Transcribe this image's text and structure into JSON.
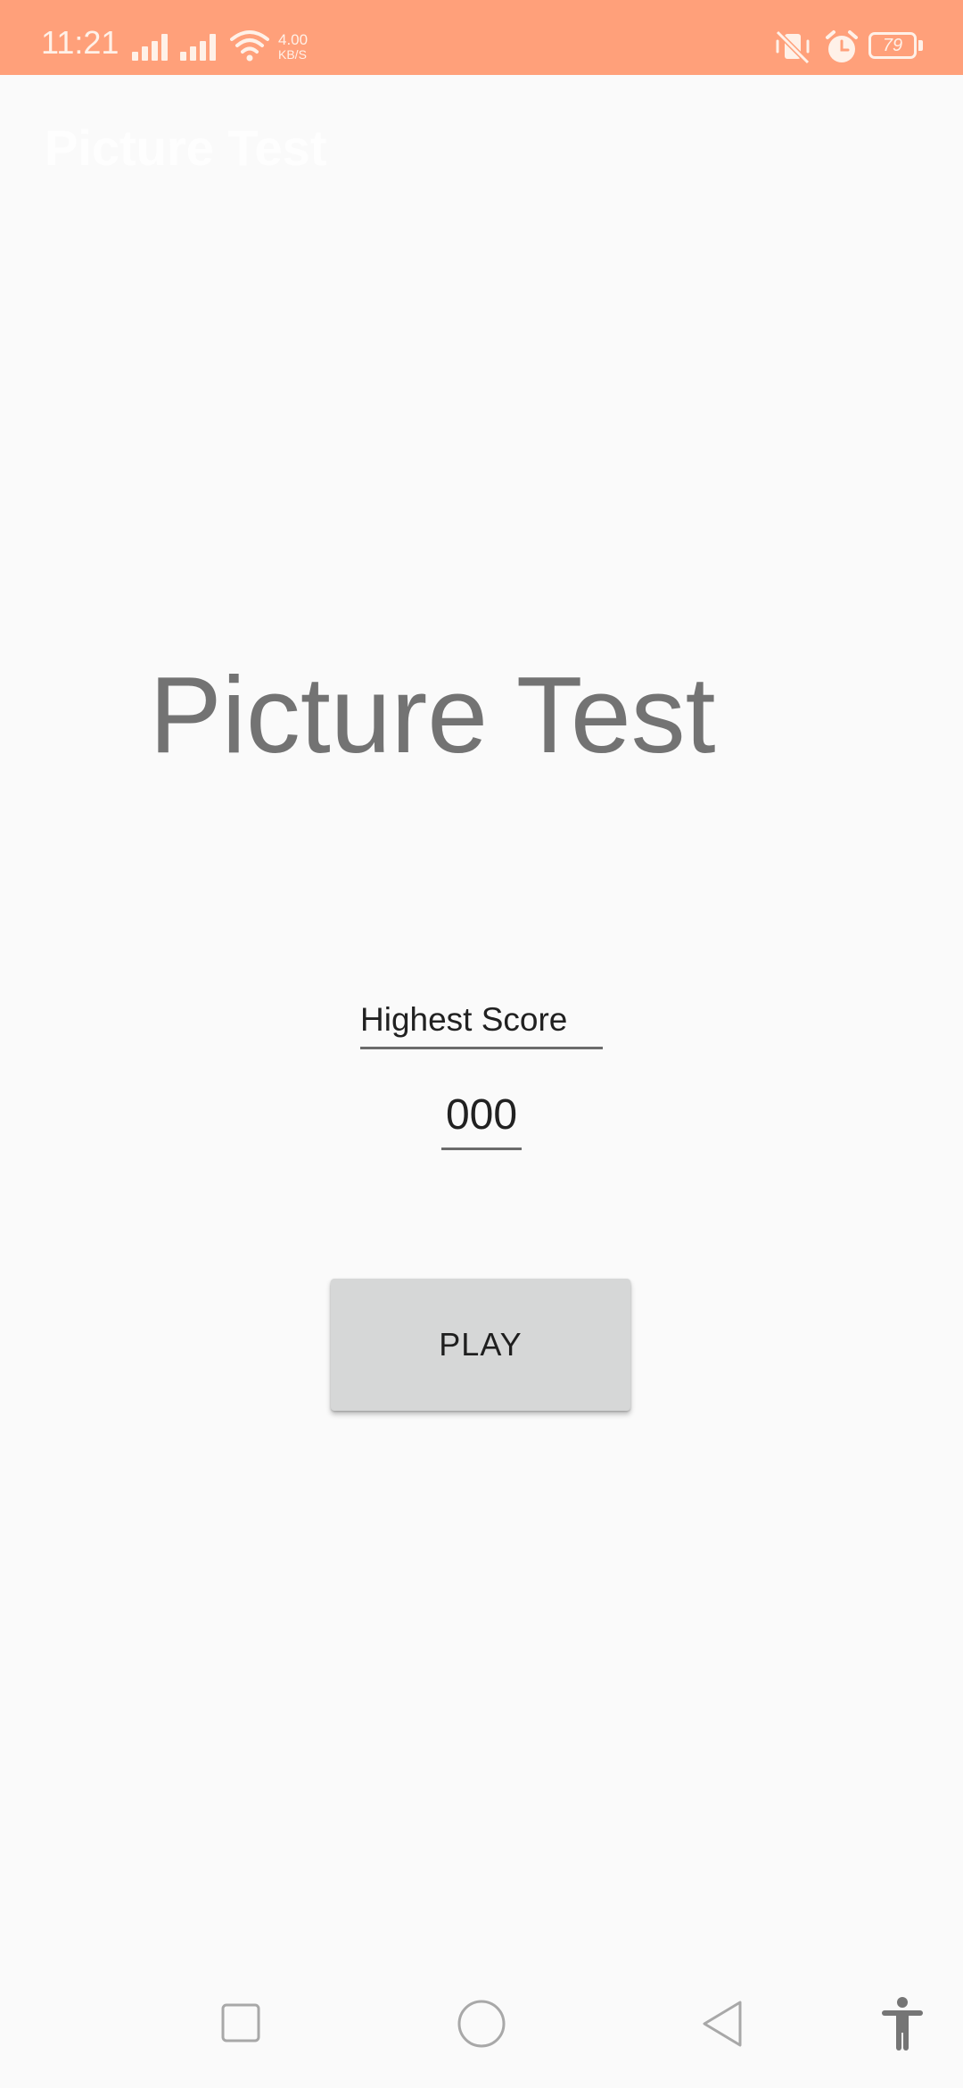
{
  "status_bar": {
    "time": "11:21",
    "net_speed_value": "4.00",
    "net_speed_unit": "KB/S",
    "battery": "79",
    "icons": [
      "signal-icon",
      "signal-icon",
      "wifi-icon",
      "mute-icon",
      "alarm-icon",
      "battery-icon"
    ]
  },
  "app_bar": {
    "title": "Picture Test"
  },
  "main": {
    "title": "Picture Test",
    "highest_score_label": "Highest Score",
    "highest_score_value": "000",
    "play_label": "PLAY"
  },
  "nav_bar": {
    "icons": [
      "recent-apps-icon",
      "home-icon",
      "back-icon",
      "accessibility-icon"
    ]
  },
  "colors": {
    "status_bar": "#ffa07a",
    "background": "#fafafa",
    "button": "#d6d7d7",
    "title_text": "#737373"
  }
}
